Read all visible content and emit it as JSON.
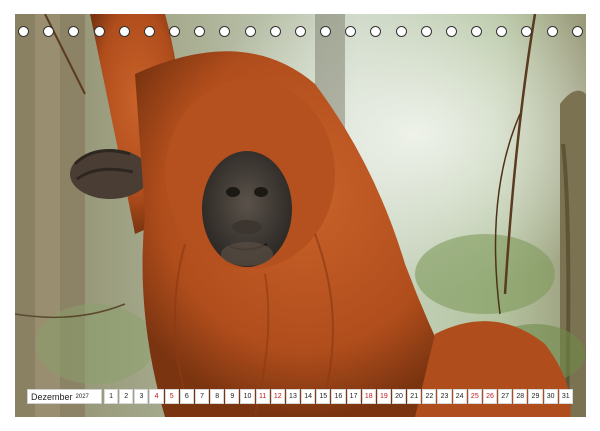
{
  "calendar": {
    "month": "Dezember",
    "year": "2027",
    "days": [
      {
        "n": "1",
        "we": false
      },
      {
        "n": "2",
        "we": false
      },
      {
        "n": "3",
        "we": false
      },
      {
        "n": "4",
        "we": true
      },
      {
        "n": "5",
        "we": true
      },
      {
        "n": "6",
        "we": false
      },
      {
        "n": "7",
        "we": false
      },
      {
        "n": "8",
        "we": false
      },
      {
        "n": "9",
        "we": false
      },
      {
        "n": "10",
        "we": false
      },
      {
        "n": "11",
        "we": true
      },
      {
        "n": "12",
        "we": true
      },
      {
        "n": "13",
        "we": false
      },
      {
        "n": "14",
        "we": false
      },
      {
        "n": "15",
        "we": false
      },
      {
        "n": "16",
        "we": false
      },
      {
        "n": "17",
        "we": false
      },
      {
        "n": "18",
        "we": true
      },
      {
        "n": "19",
        "we": true
      },
      {
        "n": "20",
        "we": false
      },
      {
        "n": "21",
        "we": false
      },
      {
        "n": "22",
        "we": false
      },
      {
        "n": "23",
        "we": false
      },
      {
        "n": "24",
        "we": false
      },
      {
        "n": "25",
        "we": true
      },
      {
        "n": "26",
        "we": true
      },
      {
        "n": "27",
        "we": false
      },
      {
        "n": "28",
        "we": false
      },
      {
        "n": "29",
        "we": false
      },
      {
        "n": "30",
        "we": false
      },
      {
        "n": "31",
        "we": false
      }
    ]
  },
  "colors": {
    "weekend": "#c01818",
    "fur": "#b5501f",
    "face": "#3a3530"
  },
  "photo_subject": "orangutan"
}
